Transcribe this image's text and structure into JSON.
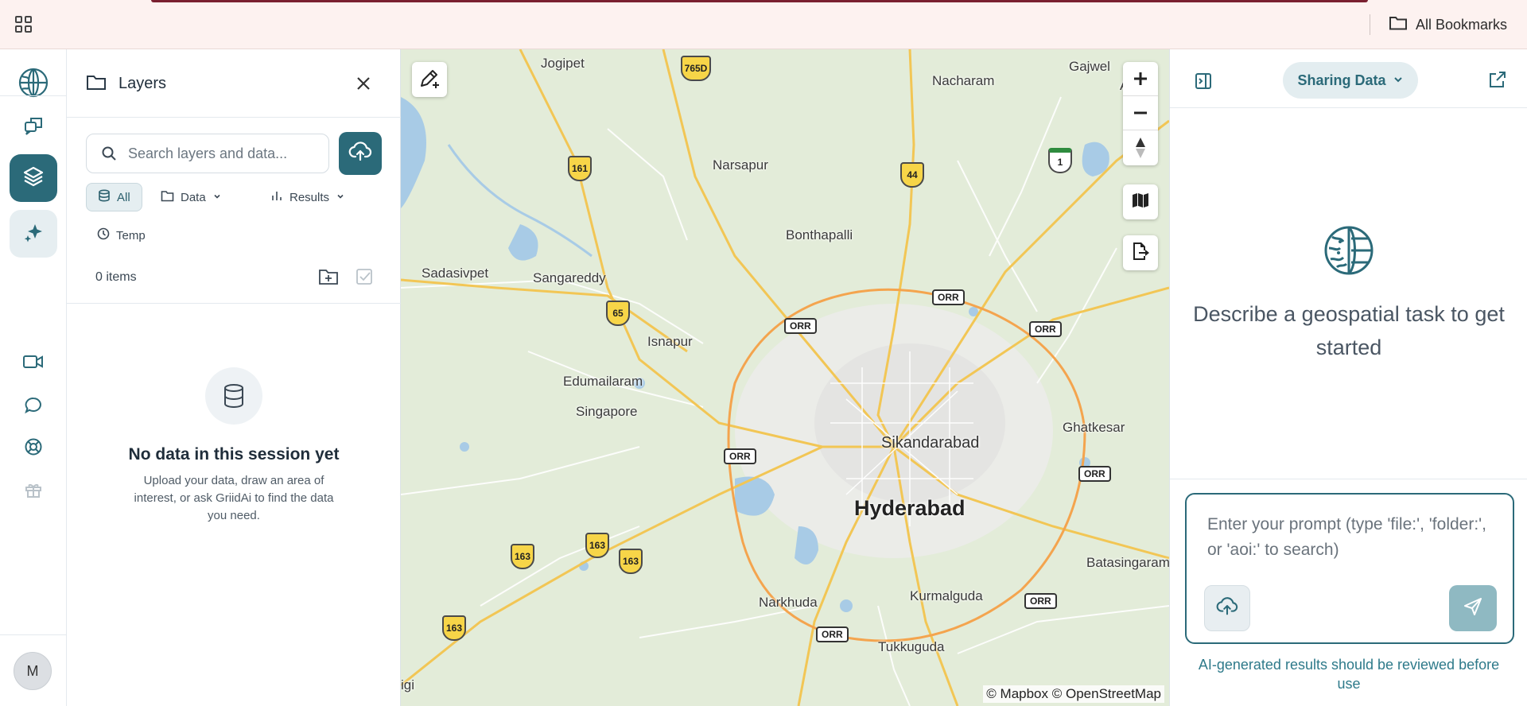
{
  "topbar": {
    "apps_icon": "grid-icon",
    "bookmarks_label": "All Bookmarks"
  },
  "rail": {
    "items": [
      "chat-history-icon",
      "layers-icon",
      "sparkles-icon",
      "video-icon",
      "comment-icon",
      "lifebuoy-icon",
      "gift-icon"
    ],
    "avatar_initial": "M"
  },
  "layers": {
    "title": "Layers",
    "search_placeholder": "Search layers and data...",
    "filters": {
      "all": "All",
      "data": "Data",
      "results": "Results",
      "temp": "Temp"
    },
    "count": "0 items",
    "empty_title": "No data in this session yet",
    "empty_desc": "Upload your data, draw an area of interest, or ask GriidAi to find the data you need."
  },
  "map": {
    "places": {
      "jogipet": "Jogipet",
      "nacharam": "Nacharam",
      "gajwel": "Gajwel",
      "narsapur": "Narsapur",
      "bonthapalli": "Bonthapalli",
      "sadasivpet": "Sadasivpet",
      "sangareddy": "Sangareddy",
      "isnapur": "Isnapur",
      "edumailaram": "Edumailaram",
      "singapore": "Singapore",
      "sikandarabad": "Sikandarabad",
      "hyderabad": "Hyderabad",
      "ghatkesar": "Ghatkesar",
      "batasingaram": "Batasingaram",
      "narkhuda": "Narkhuda",
      "kurmalguda": "Kurmalguda",
      "tukkuguda": "Tukkuguda",
      "gi": "igi",
      "aln": "Al"
    },
    "shields": {
      "s765d": "765D",
      "s161": "161",
      "s44": "44",
      "s1": "1",
      "s65": "65",
      "s163a": "163",
      "s163b": "163",
      "s163c": "163",
      "s163d": "163"
    },
    "orr_label": "ORR",
    "attribution": "© Mapbox © OpenStreetMap"
  },
  "assistant": {
    "share_label": "Sharing Data",
    "heading": "Describe a geospatial task to get started",
    "prompt_placeholder": "Enter your prompt (type 'file:', 'folder:', or 'aoi:' to search)",
    "disclaimer": "AI-generated results should be reviewed before use"
  },
  "colors": {
    "accent": "#2b6a79",
    "map_land": "#e3ecd9",
    "map_water": "#a8cbe6",
    "road_major": "#f2b64a",
    "ring_road": "#f4a44e"
  }
}
